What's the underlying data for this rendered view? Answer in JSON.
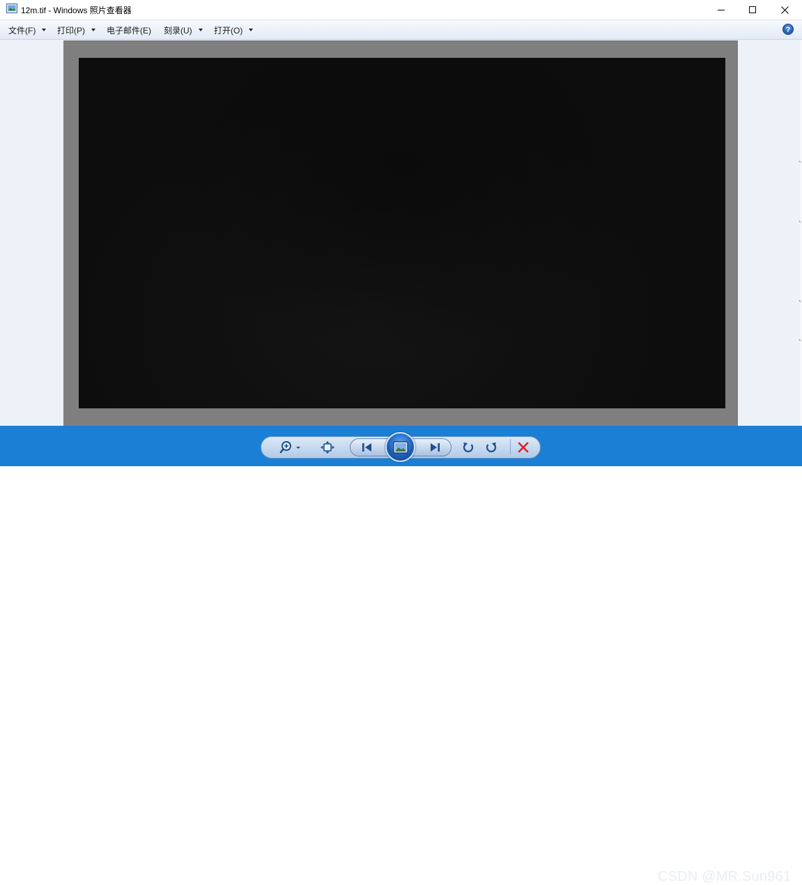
{
  "window": {
    "title": "12m.tif - Windows 照片查看器",
    "minimize_icon": "minimize-icon",
    "maximize_icon": "maximize-icon",
    "close_icon": "close-icon"
  },
  "menu": {
    "items": [
      {
        "label": "文件(F)",
        "has_dropdown": true
      },
      {
        "label": "打印(P)",
        "has_dropdown": true
      },
      {
        "label": "电子邮件(E)",
        "has_dropdown": false
      },
      {
        "label": "刻录(U)",
        "has_dropdown": true
      },
      {
        "label": "打开(O)",
        "has_dropdown": true
      }
    ],
    "help_icon": "help-icon"
  },
  "viewer": {
    "frame_color": "#7f7f7f",
    "image_color": "#0d0d0d"
  },
  "controls": {
    "buttons": [
      {
        "name": "zoom",
        "icon": "magnifier-icon"
      },
      {
        "name": "actual-size",
        "icon": "actual-size-icon"
      },
      {
        "name": "previous",
        "icon": "previous-icon"
      },
      {
        "name": "slideshow",
        "icon": "slideshow-icon"
      },
      {
        "name": "next",
        "icon": "next-icon"
      },
      {
        "name": "rotate-counterclockwise",
        "icon": "rotate-left-icon"
      },
      {
        "name": "rotate-clockwise",
        "icon": "rotate-right-icon"
      },
      {
        "name": "delete",
        "icon": "delete-icon"
      }
    ],
    "bar_color": "#1b7fd6"
  },
  "watermark": "CSDN @MR.Sun961"
}
